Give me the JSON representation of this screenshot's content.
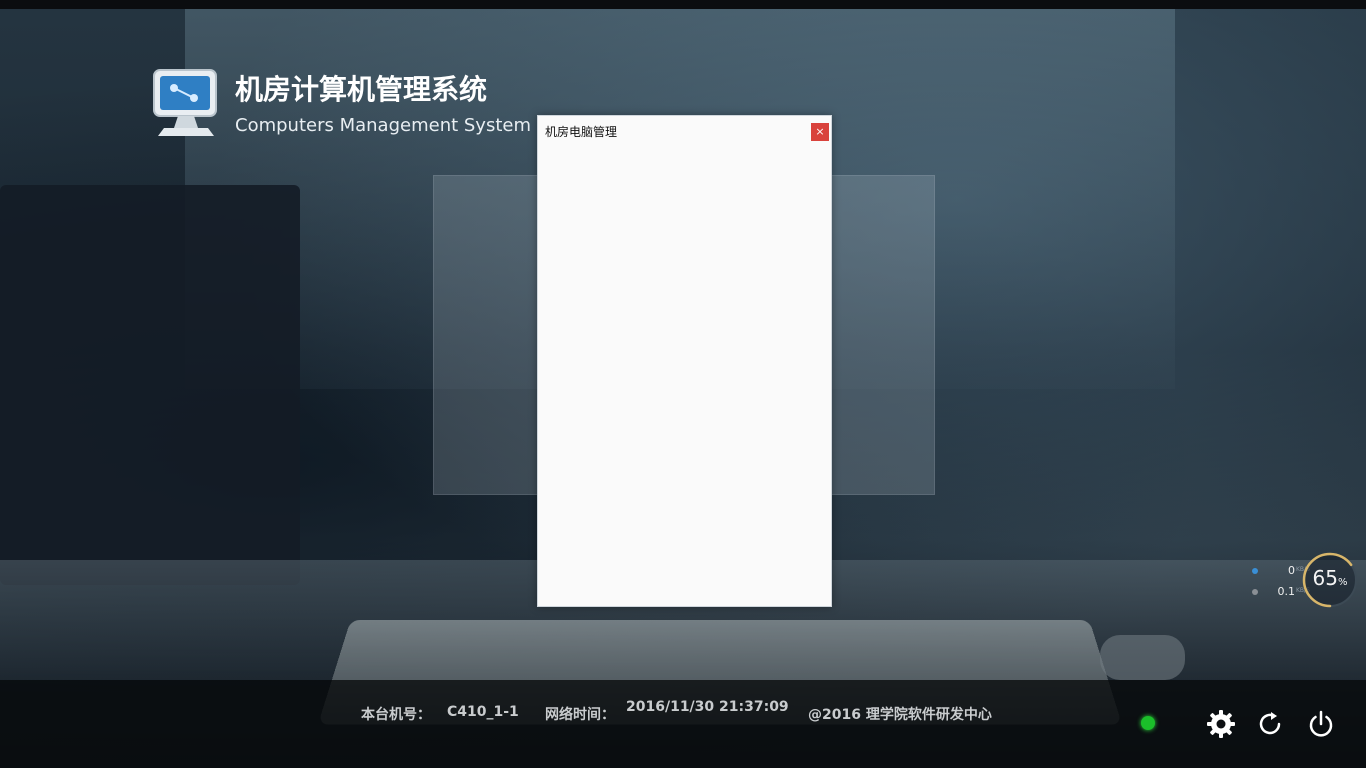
{
  "app": {
    "title": "机房计算机管理系统",
    "subtitle": "Computers Management System"
  },
  "dialog": {
    "title": "机房电脑管理",
    "close_label": "×"
  },
  "network": {
    "upload_value": "0",
    "upload_unit": "KB/S",
    "download_value": "0.1",
    "download_unit": "KB/S",
    "upload_color": "#3a8fd6",
    "download_color": "#8a8f95"
  },
  "usage_gauge": {
    "value": "65",
    "unit": "%",
    "fraction": 0.65,
    "color": "#d8b66a"
  },
  "footer": {
    "machine_label": "本台机号：",
    "machine_value": "C410_1-1",
    "time_label": "网络时间：",
    "time_value": "2016/11/30 21:37:09",
    "copyright": "@2016  理学院软件研发中心"
  },
  "status": {
    "led_color": "#1bbf2a"
  },
  "controls": {
    "settings_icon": "gear-icon",
    "restart_icon": "restart-icon",
    "shutdown_icon": "power-icon"
  }
}
